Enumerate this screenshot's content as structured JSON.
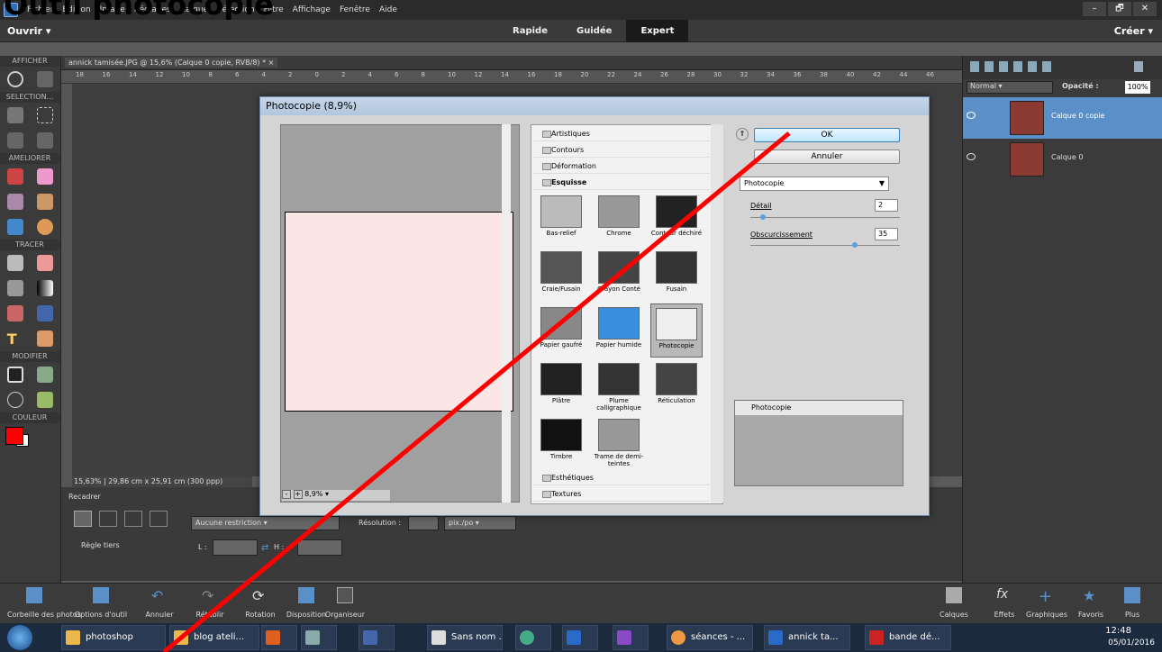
{
  "heading_text": "Outil photocopie",
  "menubar": {
    "items": [
      "Fichier",
      "Edition",
      "Image",
      "Réglages",
      "Calque",
      "Sélection",
      "Filtre",
      "Affichage",
      "Fenêtre",
      "Aide"
    ],
    "window_controls": [
      "–",
      "🗗",
      "✕"
    ]
  },
  "topbar": {
    "open_label": "Ouvrir",
    "modes": [
      "Rapide",
      "Guidée",
      "Expert"
    ],
    "create_label": "Créer"
  },
  "toolbox": {
    "sections": [
      "AFFICHER",
      "SELECTION...",
      "AMELIORER",
      "TRACER",
      "MODIFIER",
      "COULEUR"
    ]
  },
  "document": {
    "tab_title": "annick tamisée.JPG @ 15,6% (Calque 0 copie, RVB/8) * ×",
    "ruler_ticks": [
      "18",
      "16",
      "14",
      "12",
      "10",
      "8",
      "6",
      "4",
      "2",
      "0",
      "2",
      "4",
      "6",
      "8",
      "10",
      "12",
      "14",
      "16",
      "18",
      "20",
      "22",
      "24",
      "26",
      "28",
      "30",
      "32",
      "34",
      "36",
      "38",
      "40",
      "42",
      "44",
      "46"
    ],
    "status_zoom": "15,63%",
    "status_size": "29,86 cm x 25,91 cm (300 ppp)"
  },
  "options": {
    "title": "Recadrer",
    "grid_label": "Règle tiers",
    "restriction": "Aucune restriction",
    "resolution_label": "Résolution :",
    "resolution_unit": "pix./po",
    "l_label": "L :",
    "h_label": "H :"
  },
  "layers": {
    "blend_mode": "Normal",
    "opacity_label": "Opacité :",
    "opacity_value": "100%",
    "items": [
      {
        "name": "Calque 0 copie",
        "selected": true
      },
      {
        "name": "Calque 0",
        "selected": false
      }
    ]
  },
  "bottombar": {
    "left": [
      "Corbeille des photos",
      "Options d'outil",
      "Annuler",
      "Rétablir",
      "Rotation",
      "Disposition",
      "Organiseur"
    ],
    "right": [
      "Calques",
      "Effets",
      "Graphiques",
      "Favoris",
      "Plus"
    ]
  },
  "taskbar": {
    "items": [
      "photoshop",
      "blog ateli...",
      "Sans nom ...",
      "séances - ...",
      "annick ta...",
      "bande dé..."
    ],
    "time": "12:48",
    "date": "05/01/2016"
  },
  "dialog": {
    "title": "Photocopie (8,9%)",
    "zoom": "8,9%",
    "categories_top": [
      "Artistiques",
      "Contours",
      "Déformation"
    ],
    "open_category": "Esquisse",
    "filters": [
      "Bas-relief",
      "Chrome",
      "Contour déchiré",
      "Craie/Fusain",
      "Crayon Conté",
      "Fusain",
      "Papier gaufré",
      "Papier humide",
      "Photocopie",
      "Plâtre",
      "Plume calligraphique",
      "Réticulation",
      "Timbre",
      "Trame de demi-teintes"
    ],
    "categories_bottom": [
      "Esthétiques",
      "Textures"
    ],
    "ok_label": "OK",
    "cancel_label": "Annuler",
    "filter_select": "Photocopie",
    "param1_label": "Détail",
    "param1_value": "2",
    "param2_label": "Obscurcissement",
    "param2_value": "35",
    "effect_layer": "Photocopie"
  },
  "colors": {
    "annotation_line": "#ff0000",
    "accent": "#5a8fc8",
    "fg_swatch": "#ff0000"
  }
}
